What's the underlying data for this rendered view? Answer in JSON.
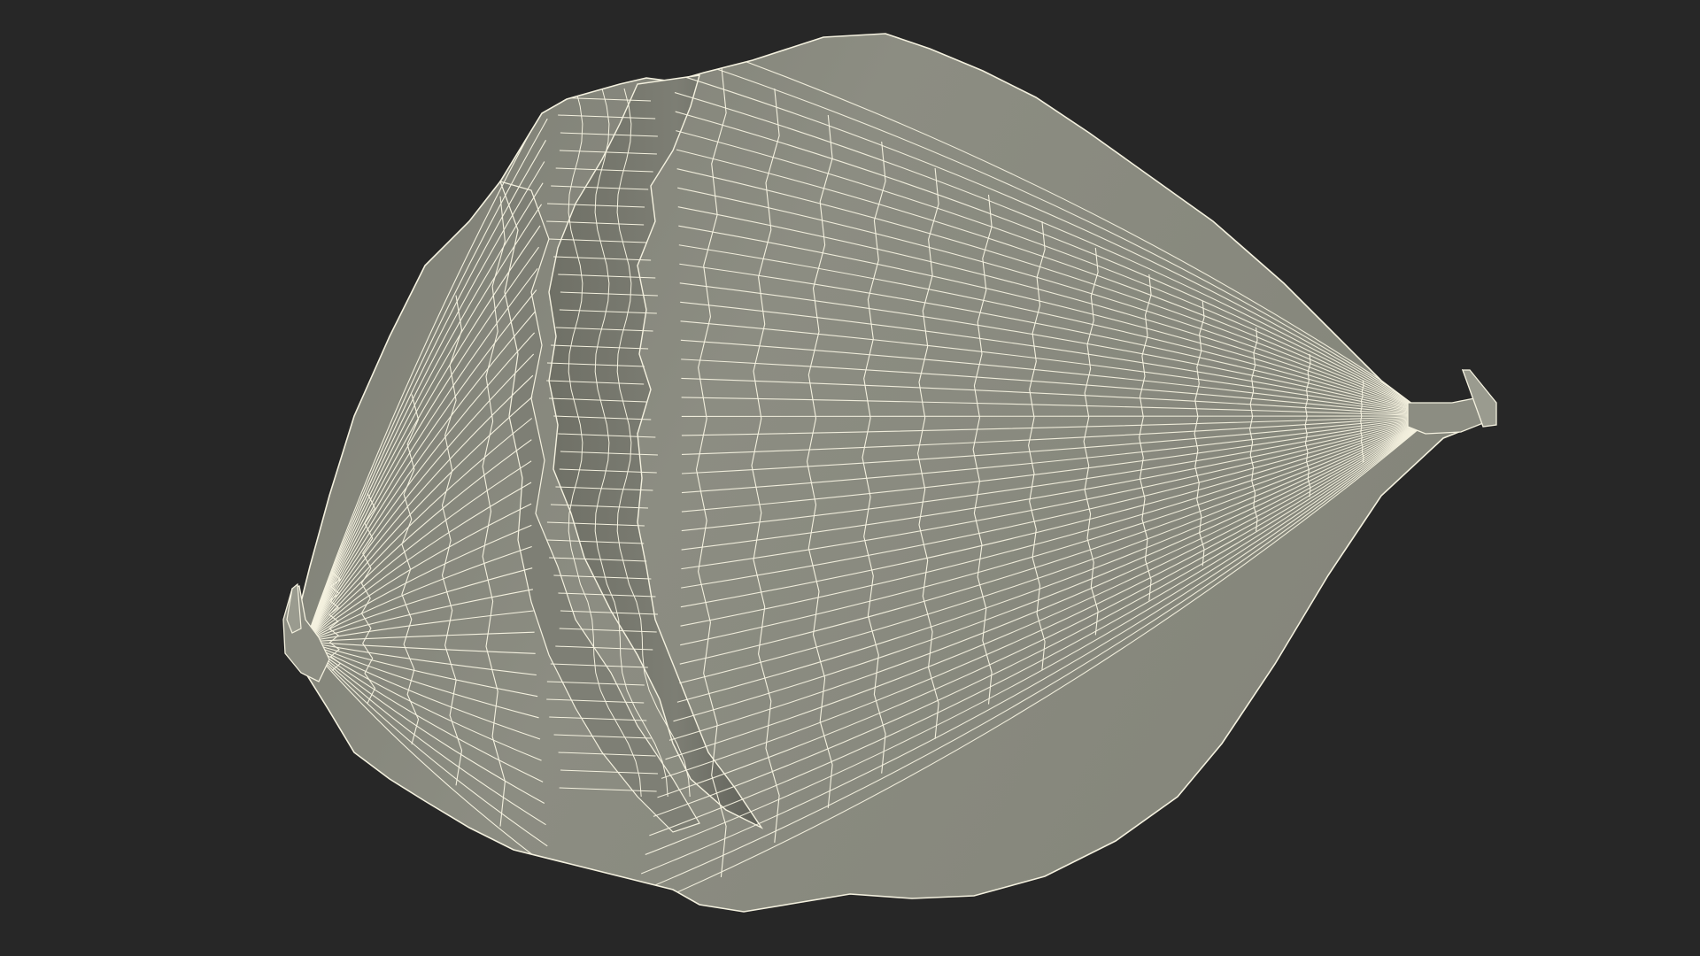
{
  "scene": {
    "background_color": "#272727",
    "surface_color": "#8a8b80",
    "surface_shadow_color": "#6d6e64",
    "surface_highlight_color": "#a3a498",
    "wire_color": "#f4f1df",
    "subject": "wireframe-seed-render"
  }
}
